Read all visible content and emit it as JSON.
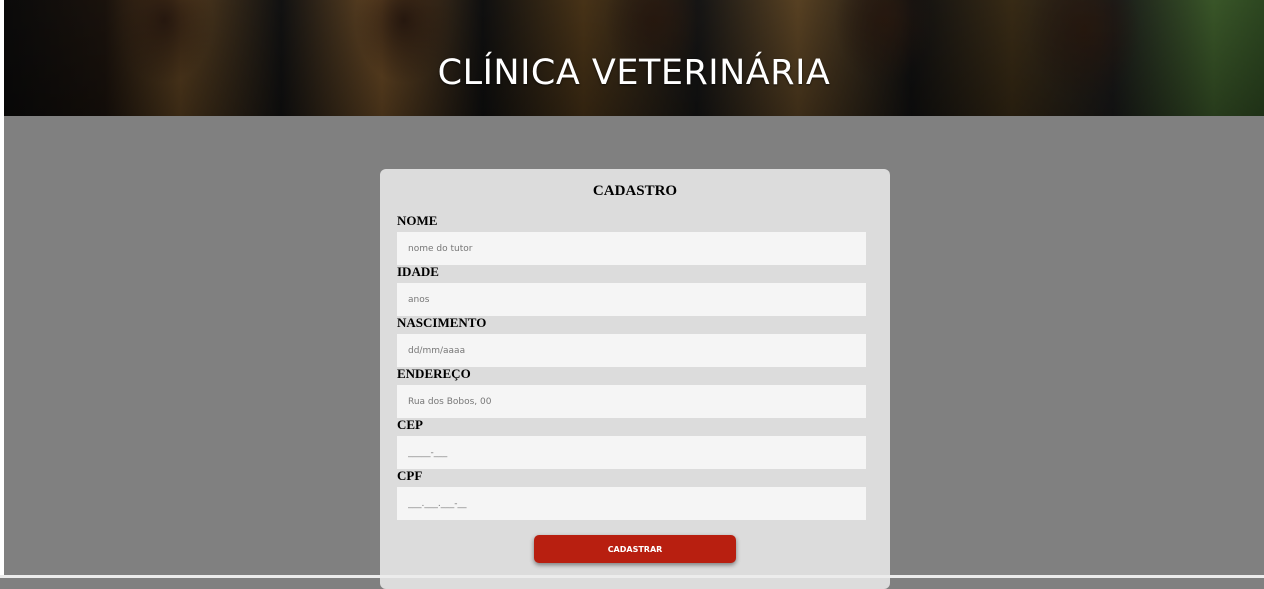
{
  "header": {
    "title": "CLÍNICA VETERINÁRIA"
  },
  "form": {
    "title": "CADASTRO",
    "fields": [
      {
        "label": "NOME",
        "placeholder": "nome do tutor"
      },
      {
        "label": "IDADE",
        "placeholder": "anos"
      },
      {
        "label": "NASCIMENTO",
        "placeholder": "dd/mm/aaaa"
      },
      {
        "label": "ENDEREÇO",
        "placeholder": "Rua dos Bobos, 00"
      },
      {
        "label": "CEP",
        "placeholder": "_____-___"
      },
      {
        "label": "CPF",
        "placeholder": "___.___.___-__"
      }
    ],
    "submit_label": "CADASTRAR"
  },
  "colors": {
    "background": "#808080",
    "card": "#dcdcdc",
    "button": "#b81f10"
  }
}
